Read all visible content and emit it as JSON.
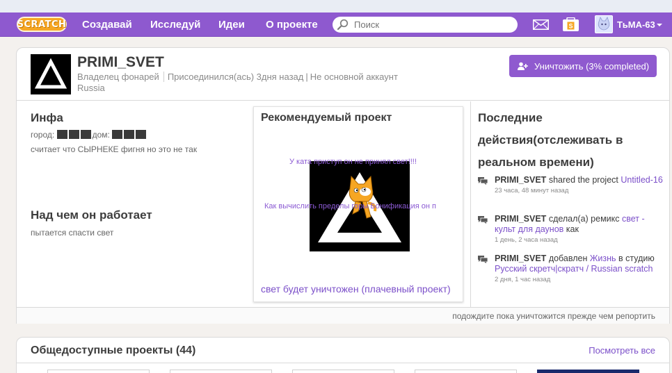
{
  "brand": {
    "logo_text": "SCRATCH",
    "accent": "#8e59cf",
    "link_color": "#7b4fc9"
  },
  "nav": {
    "items": [
      "Создавай",
      "Исследуй",
      "Идеи",
      "О проекте"
    ],
    "search_placeholder": "Поиск",
    "icons": [
      "messages-icon",
      "my-stuff-icon"
    ],
    "username": "ТьМА-63"
  },
  "profile": {
    "name": "PRIMI_SVET",
    "role": "Владелец фонарей",
    "joined": "Присоединился(ась) 3дня назад",
    "account_type": "Не основной аккаунт",
    "country": "Russia",
    "action_button": "Уничтожить (3% completed)"
  },
  "about": {
    "title": "Инфа",
    "city_label": "город:",
    "house_label": "дом:",
    "bio": "считает что СЫРНЕКЕ фигня но это не так"
  },
  "working_on": {
    "title": "Над чем он работает",
    "text": "пытается спасти свет"
  },
  "featured": {
    "title": "Рекомендуемый проект",
    "overlay_line1": "У ката приступ он не принял свет!!!!",
    "overlay_line2": "Как вычислить пределы горы Бонификация он п",
    "project_link": "свет будет уничтожен (плачевный проект)"
  },
  "activity": {
    "title": "Последние действия(отслеживать в реальном времени)",
    "items": [
      {
        "user": "PRIMI_SVET",
        "verb": "shared the project",
        "target": "Untitled-16",
        "time": "23 часа, 48 минут назад"
      },
      {
        "user": "PRIMI_SVET",
        "verb": "сделал(а) ремикс",
        "target": "свет - культ для даунов",
        "suffix": "как",
        "time": "1 день, 2 часа назад"
      },
      {
        "user": "PRIMI_SVET",
        "verb": "добавлен",
        "target": "Жизнь",
        "suffix": "в студию",
        "target2": "Русский скретч|скратч / Russian scratch",
        "time": "2 дня, 1 час назад"
      }
    ]
  },
  "footer_note": "подождите пока уничтожится прежде чем репортить",
  "shared_projects": {
    "title": "Общедоступные проекты (44)",
    "see_all": "Посмотреть все"
  }
}
